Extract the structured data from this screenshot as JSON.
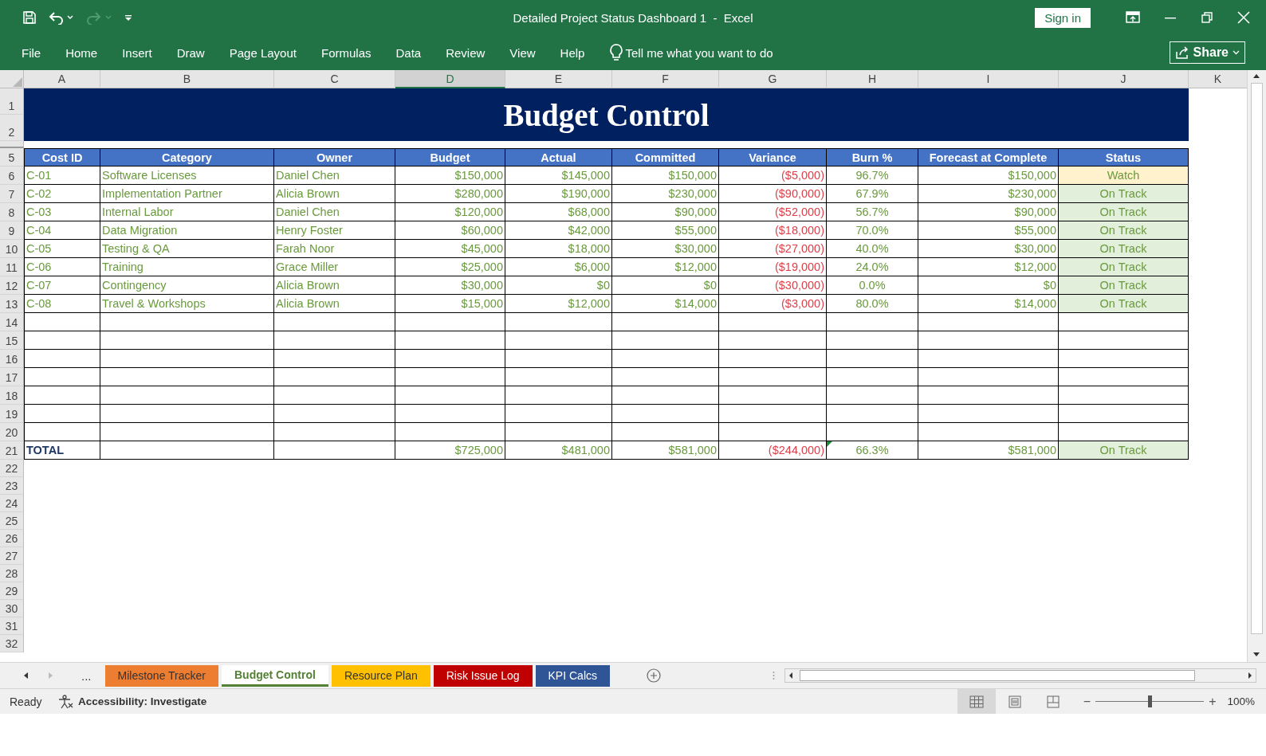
{
  "window": {
    "title": "Detailed Project Status Dashboard 1  -  Excel",
    "sign_in": "Sign in"
  },
  "ribbon": {
    "tabs": [
      "File",
      "Home",
      "Insert",
      "Draw",
      "Page Layout",
      "Formulas",
      "Data",
      "Review",
      "View",
      "Help"
    ],
    "tell_me": {
      "placeholder": "Tell me what you want to do"
    },
    "share": "Share"
  },
  "column_letters": [
    {
      "label": "A",
      "selected": false
    },
    {
      "label": "B",
      "selected": false
    },
    {
      "label": "C",
      "selected": false
    },
    {
      "label": "D",
      "selected": true
    },
    {
      "label": "E",
      "selected": false
    },
    {
      "label": "F",
      "selected": false
    },
    {
      "label": "G",
      "selected": false
    },
    {
      "label": "H",
      "selected": false
    },
    {
      "label": "I",
      "selected": false
    },
    {
      "label": "J",
      "selected": false
    },
    {
      "label": "K",
      "selected": false
    }
  ],
  "sheet": {
    "title_row_numbers": [
      "1",
      "2"
    ],
    "title": "Budget Control",
    "header": {
      "row_number": "5",
      "cells": [
        "Cost ID",
        "Category",
        "Owner",
        "Budget",
        "Actual",
        "Committed",
        "Variance",
        "Burn %",
        "Forecast at Complete",
        "Status"
      ]
    },
    "rows": [
      {
        "row_number": "6",
        "cost_id": "C-01",
        "category": "Software Licenses",
        "owner": "Daniel Chen",
        "budget": "$150,000",
        "actual": "$145,000",
        "committed": "$150,000",
        "variance": "($5,000)",
        "burn": "96.7%",
        "forecast": "$150,000",
        "status": {
          "text": "Watch",
          "kind": "watch"
        }
      },
      {
        "row_number": "7",
        "cost_id": "C-02",
        "category": "Implementation Partner",
        "owner": "Alicia Brown",
        "budget": "$280,000",
        "actual": "$190,000",
        "committed": "$230,000",
        "variance": "($90,000)",
        "burn": "67.9%",
        "forecast": "$230,000",
        "status": {
          "text": "On Track",
          "kind": "on_track"
        }
      },
      {
        "row_number": "8",
        "cost_id": "C-03",
        "category": "Internal Labor",
        "owner": "Daniel Chen",
        "budget": "$120,000",
        "actual": "$68,000",
        "committed": "$90,000",
        "variance": "($52,000)",
        "burn": "56.7%",
        "forecast": "$90,000",
        "status": {
          "text": "On Track",
          "kind": "on_track"
        }
      },
      {
        "row_number": "9",
        "cost_id": "C-04",
        "category": "Data Migration",
        "owner": "Henry Foster",
        "budget": "$60,000",
        "actual": "$42,000",
        "committed": "$55,000",
        "variance": "($18,000)",
        "burn": "70.0%",
        "forecast": "$55,000",
        "status": {
          "text": "On Track",
          "kind": "on_track"
        }
      },
      {
        "row_number": "10",
        "cost_id": "C-05",
        "category": "Testing & QA",
        "owner": "Farah Noor",
        "budget": "$45,000",
        "actual": "$18,000",
        "committed": "$30,000",
        "variance": "($27,000)",
        "burn": "40.0%",
        "forecast": "$30,000",
        "status": {
          "text": "On Track",
          "kind": "on_track"
        }
      },
      {
        "row_number": "11",
        "cost_id": "C-06",
        "category": "Training",
        "owner": "Grace Miller",
        "budget": "$25,000",
        "actual": "$6,000",
        "committed": "$12,000",
        "variance": "($19,000)",
        "burn": "24.0%",
        "forecast": "$12,000",
        "status": {
          "text": "On Track",
          "kind": "on_track"
        }
      },
      {
        "row_number": "12",
        "cost_id": "C-07",
        "category": "Contingency",
        "owner": "Alicia Brown",
        "budget": "$30,000",
        "actual": "$0",
        "committed": "$0",
        "variance": "($30,000)",
        "burn": "0.0%",
        "forecast": "$0",
        "status": {
          "text": "On Track",
          "kind": "on_track"
        }
      },
      {
        "row_number": "13",
        "cost_id": "C-08",
        "category": "Travel & Workshops",
        "owner": "Alicia Brown",
        "budget": "$15,000",
        "actual": "$12,000",
        "committed": "$14,000",
        "variance": "($3,000)",
        "burn": "80.0%",
        "forecast": "$14,000",
        "status": {
          "text": "On Track",
          "kind": "on_track"
        }
      }
    ],
    "empty_row_numbers": [
      "14",
      "15",
      "16",
      "17",
      "18",
      "19",
      "20"
    ],
    "total": {
      "row_number": "21",
      "label": "TOTAL",
      "budget": "$725,000",
      "actual": "$481,000",
      "committed": "$581,000",
      "variance": "($244,000)",
      "burn": "66.3%",
      "forecast": "$581,000",
      "status": {
        "text": "On Track",
        "kind": "on_track"
      },
      "error_flag": true
    },
    "below_row_numbers": [
      "22",
      "23",
      "24",
      "25",
      "26",
      "27",
      "28",
      "29",
      "30",
      "31",
      "32"
    ]
  },
  "sheet_tabs": {
    "more": "...",
    "tabs": [
      {
        "label": "Milestone Tracker",
        "color": "#ed7d31",
        "selected": false
      },
      {
        "label": "Budget Control",
        "color": "#548235",
        "selected": true
      },
      {
        "label": "Resource Plan",
        "color": "#ffc000",
        "selected": false
      },
      {
        "label": "Risk Issue Log",
        "color": "#c00000",
        "selected": false
      },
      {
        "label": "KPI Calcs",
        "color": "#2f5597",
        "selected": false
      }
    ]
  },
  "status_bar": {
    "mode": "Ready",
    "accessibility": "Accessibility: Investigate",
    "views": [
      {
        "kind": "normal",
        "selected": true
      },
      {
        "kind": "page_layout",
        "selected": false
      },
      {
        "kind": "page_break",
        "selected": false
      }
    ],
    "zoom_minus": "−",
    "zoom_plus": "+",
    "zoom": {
      "level": 0.5
    },
    "zoom_percent": "100%"
  }
}
